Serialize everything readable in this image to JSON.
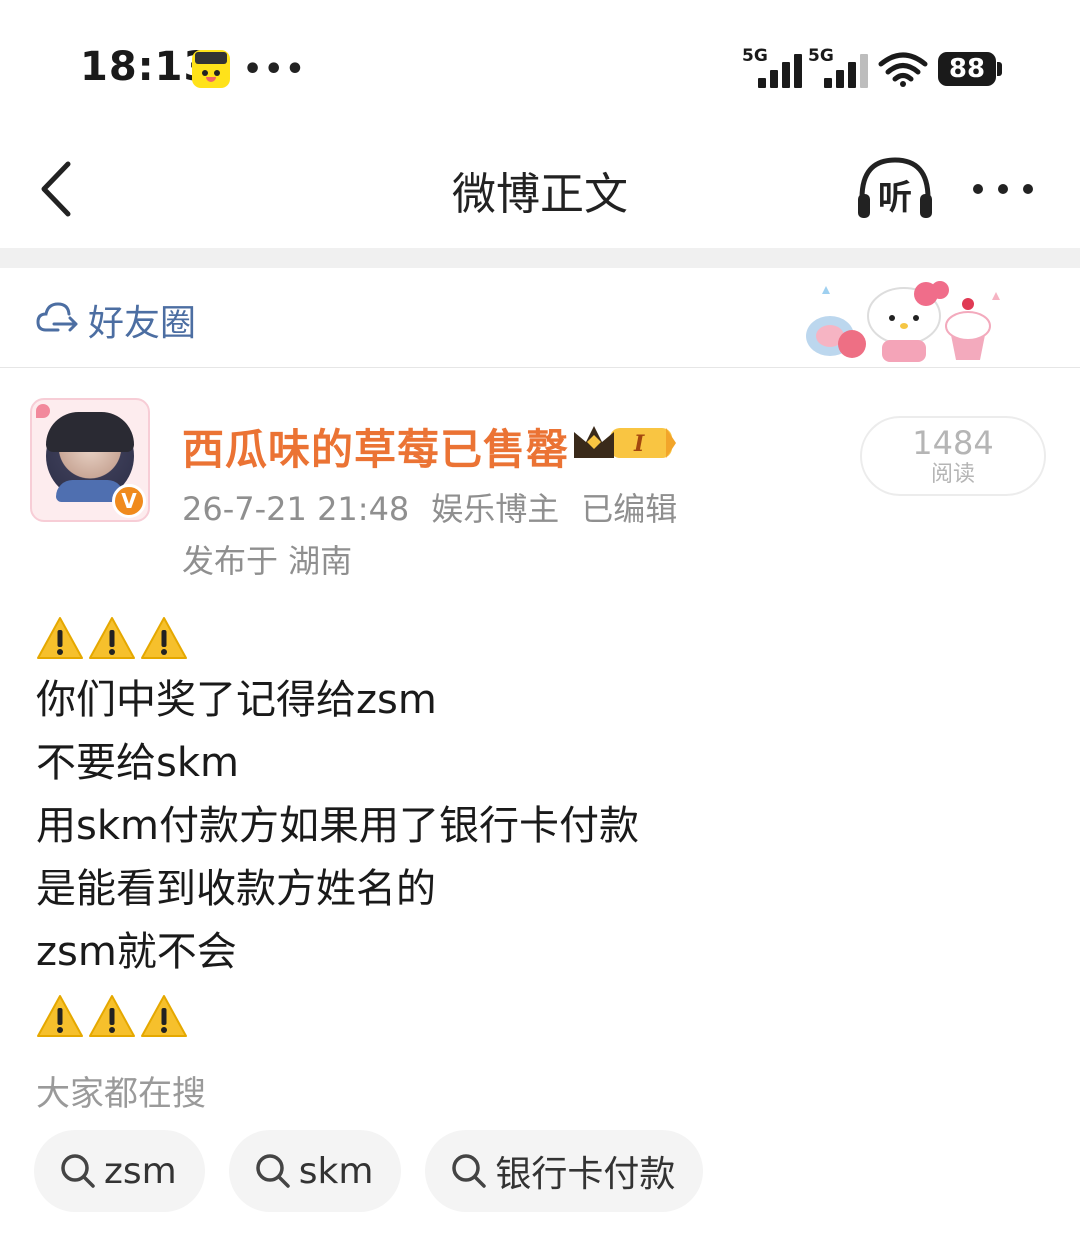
{
  "status_bar": {
    "time": "18:13",
    "notification_icon": "xianyu-app-icon",
    "more_dots": "•••",
    "signal_1": "5G",
    "signal_2": "5G",
    "battery": "88"
  },
  "nav": {
    "title": "微博正文",
    "back_icon": "chevron-left-icon",
    "listen_label": "听",
    "more_icon": "more-dots-icon"
  },
  "visibility": {
    "label": "好友圈",
    "icon": "cloud-people-icon"
  },
  "post": {
    "username": "西瓜味的草莓已售罄",
    "member_badge": "I",
    "meta": {
      "time": "26-7-21 21:48",
      "role": "娱乐博主",
      "edited": "已编辑",
      "location": "发布于 湖南"
    },
    "reads": {
      "count": "1484",
      "label": "阅读"
    },
    "lines": [
      "你们中奖了记得给zsm",
      "不要给skm",
      "用skm付款方如果用了银行卡付款",
      "是能看到收款方姓名的",
      "zsm就不会"
    ],
    "warning_icon": "warning-icon"
  },
  "search": {
    "title": "大家都在搜",
    "chips": [
      "zsm",
      "skm",
      "银行卡付款"
    ]
  },
  "colors": {
    "username": "#eb7334",
    "circle_label": "#4c6ea2",
    "meta": "#8f8f8f",
    "warning": "#f6c02c"
  }
}
